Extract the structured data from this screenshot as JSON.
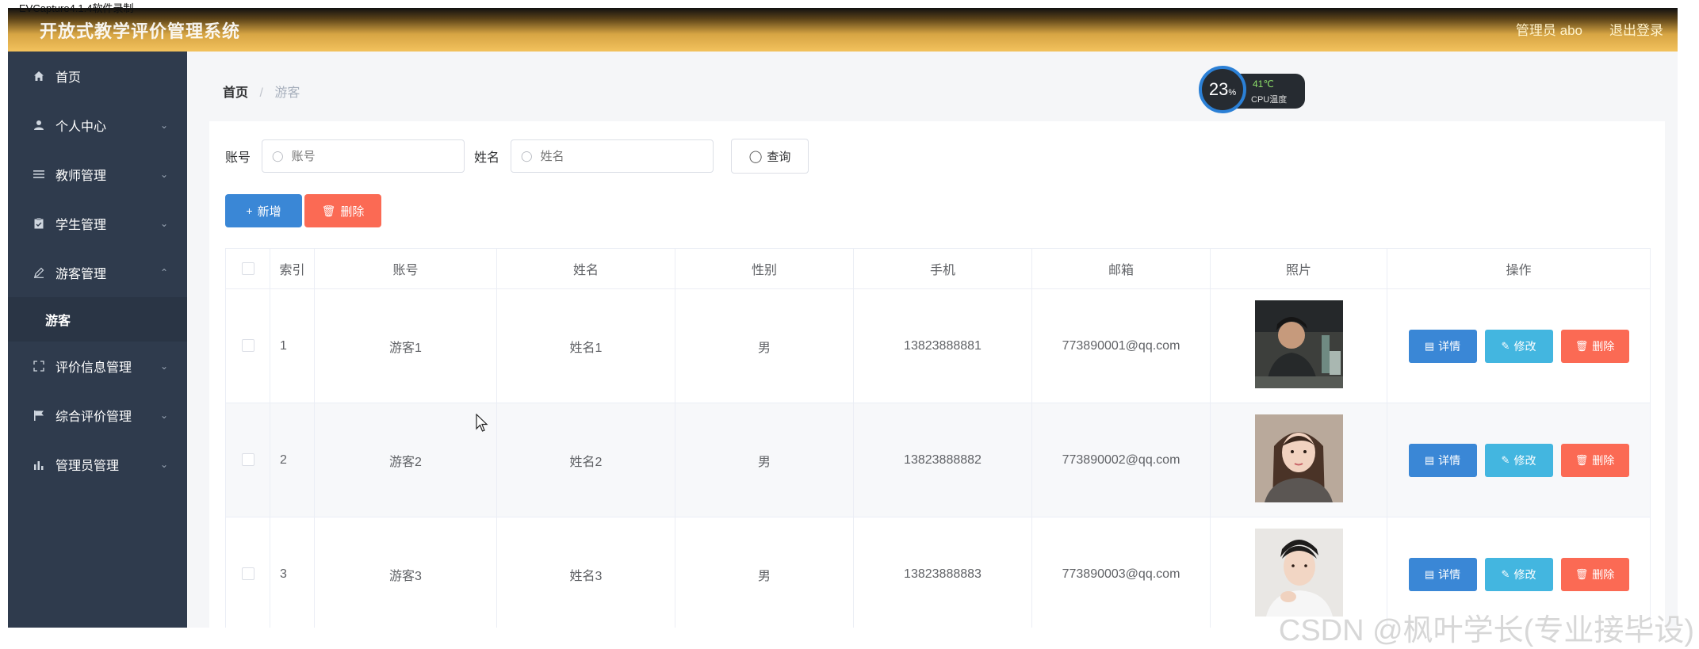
{
  "capture_label": "EVCapture4.1.4软件录制",
  "header": {
    "title": "开放式教学评价管理系统",
    "admin": "管理员 abo",
    "logout": "退出登录"
  },
  "sidebar": {
    "items": [
      {
        "label": "首页",
        "icon": "home-icon"
      },
      {
        "label": "个人中心",
        "icon": "user-icon"
      },
      {
        "label": "教师管理",
        "icon": "list-icon"
      },
      {
        "label": "学生管理",
        "icon": "clipboard-icon"
      },
      {
        "label": "游客管理",
        "icon": "edit-icon"
      },
      {
        "label": "评价信息管理",
        "icon": "fullscreen-icon"
      },
      {
        "label": "综合评价管理",
        "icon": "flag-icon"
      },
      {
        "label": "管理员管理",
        "icon": "bar-chart-icon"
      }
    ],
    "sub_item": "游客"
  },
  "breadcrumb": {
    "home": "首页",
    "sep": "/",
    "current": "游客"
  },
  "cpu": {
    "usage_value": "23",
    "usage_unit": "%",
    "temp": "41℃",
    "label": "CPU温度"
  },
  "search": {
    "account_label": "账号",
    "account_placeholder": "账号",
    "name_label": "姓名",
    "name_placeholder": "姓名",
    "query_button": "查询"
  },
  "actions": {
    "add": "新增",
    "delete": "删除"
  },
  "table": {
    "headers": [
      "索引",
      "账号",
      "姓名",
      "性别",
      "手机",
      "邮箱",
      "照片",
      "操作"
    ],
    "rows": [
      {
        "index": "1",
        "account": "游客1",
        "name": "姓名1",
        "gender": "男",
        "phone": "13823888881",
        "email": "773890001@qq.com"
      },
      {
        "index": "2",
        "account": "游客2",
        "name": "姓名2",
        "gender": "男",
        "phone": "13823888882",
        "email": "773890002@qq.com"
      },
      {
        "index": "3",
        "account": "游客3",
        "name": "姓名3",
        "gender": "男",
        "phone": "13823888883",
        "email": "773890003@qq.com"
      }
    ],
    "ops": {
      "detail": "详情",
      "edit": "修改",
      "delete": "删除"
    }
  },
  "watermark": "CSDN @枫叶学长(专业接毕设)",
  "colors": {
    "sidebar_bg": "#2f3b4d",
    "header_gold": "#f3c25d",
    "primary": "#3a87d6",
    "info": "#43b6e0",
    "danger": "#fb6a54"
  }
}
